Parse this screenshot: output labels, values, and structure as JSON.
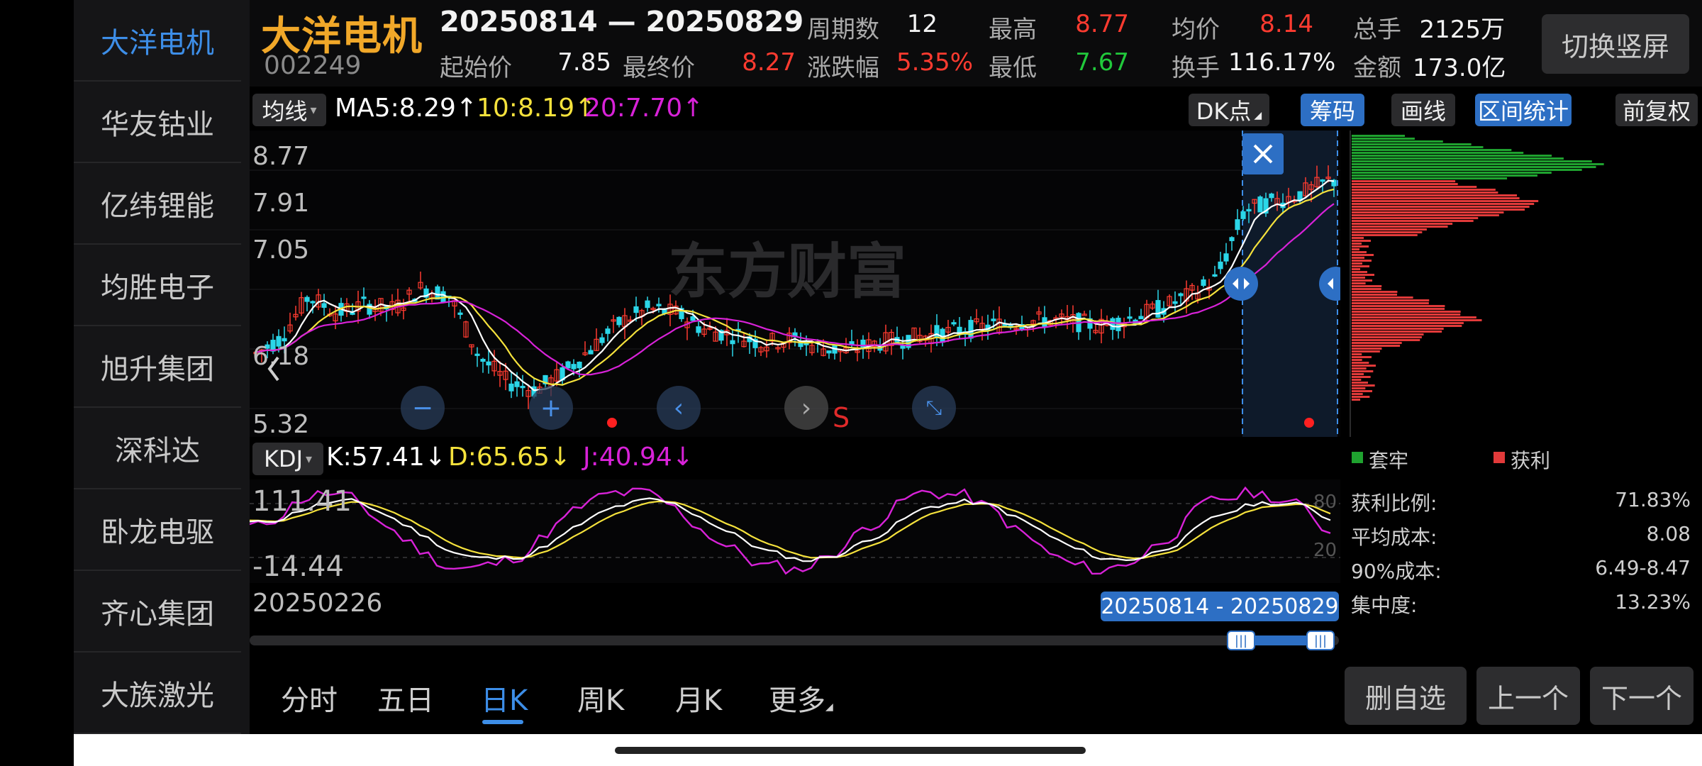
{
  "sidebar": {
    "items": [
      {
        "label": "大洋电机",
        "active": true
      },
      {
        "label": "华友钴业"
      },
      {
        "label": "亿纬锂能"
      },
      {
        "label": "均胜电子"
      },
      {
        "label": "旭升集团"
      },
      {
        "label": "深科达"
      },
      {
        "label": "卧龙电驱"
      },
      {
        "label": "齐心集团"
      },
      {
        "label": "大族激光"
      }
    ]
  },
  "header": {
    "name": "大洋电机",
    "code": "002249",
    "range": "20250814 — 20250829",
    "stats": {
      "start_label": "起始价",
      "start_value": "7.85",
      "end_label": "最终价",
      "end_value": "8.27",
      "periods_label": "周期数",
      "periods_value": "12",
      "change_label": "涨跌幅",
      "change_value": "5.35%",
      "high_label": "最高",
      "high_value": "8.77",
      "low_label": "最低",
      "low_value": "7.67",
      "avg_label": "均价",
      "avg_value": "8.14",
      "turnover_label": "换手",
      "turnover_value": "116.17%",
      "volume_label": "总手",
      "volume_value": "2125万",
      "amount_label": "金额",
      "amount_value": "173.0亿"
    },
    "portrait_button": "切换竖屏"
  },
  "toolbar": {
    "indicator_select": "均线",
    "ma5": "MA5:8.29↑",
    "ma10": "10:8.19↑",
    "ma20": "20:7.70↑",
    "dk_button": "DK点",
    "chips_button": "筹码",
    "draw_button": "画线",
    "interval_button": "区间统计",
    "adjust_button": "前复权"
  },
  "kline": {
    "y_labels": [
      "8.77",
      "7.91",
      "7.05",
      "6.18",
      "5.32"
    ],
    "watermark": "东方财富",
    "s_marker": "S"
  },
  "kdj": {
    "select": "KDJ",
    "k": "K:57.41↓",
    "d": "D:65.65↓",
    "j": "J:40.94↓",
    "top_value": "111.41",
    "bottom_value": "-14.44",
    "level_80": "80",
    "level_20": "20"
  },
  "timeline": {
    "start_date": "20250226",
    "selected_range": "20250814 - 20250829"
  },
  "chips": {
    "legend_trapped": "套牢",
    "legend_profit": "获利",
    "profit_ratio_label": "获利比例:",
    "profit_ratio_value": "71.83%",
    "avg_cost_label": "平均成本:",
    "avg_cost_value": "8.08",
    "cost90_label": "90%成本:",
    "cost90_value": "6.49-8.47",
    "concentration_label": "集中度:",
    "concentration_value": "13.23%"
  },
  "tabs": [
    "分时",
    "五日",
    "日K",
    "周K",
    "月K",
    "更多"
  ],
  "actions": {
    "remove": "删自选",
    "prev": "上一个",
    "next": "下一个"
  },
  "colors": {
    "accent": "#3d8ee8",
    "up": "#ff3b30",
    "down": "#2bd6e8",
    "ma5": "#ffffff",
    "ma10": "#f5e23c",
    "ma20": "#d822d8",
    "name": "#f1a829"
  },
  "chart_data": {
    "type": "candlestick",
    "title": "大洋电机 日K",
    "ylim": [
      5.32,
      8.77
    ],
    "y_ticks": [
      8.77,
      7.91,
      7.05,
      6.18,
      5.32
    ],
    "series": [
      {
        "name": "MA5",
        "values": [
          8.29
        ]
      },
      {
        "name": "MA10",
        "values": [
          8.19
        ]
      },
      {
        "name": "MA20",
        "values": [
          7.7
        ]
      }
    ],
    "interval": {
      "start": "20250814",
      "end": "20250829",
      "high": 8.77,
      "low": 7.67,
      "start_price": 7.85,
      "end_price": 8.27
    },
    "kdj": {
      "K": 57.41,
      "D": 65.65,
      "J": 40.94,
      "range": [
        -14.44,
        111.41
      ]
    }
  }
}
